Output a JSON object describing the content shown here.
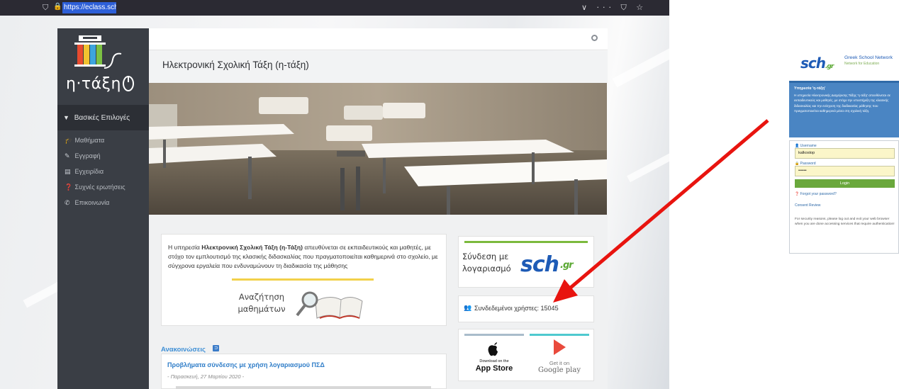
{
  "browser": {
    "url": "https://eclass.sch.gr",
    "toolbar_icons": "∨ ··· ⛉ ☆"
  },
  "site": {
    "logo_text": "η·τάξη",
    "page_title": "Ηλεκτρονική Σχολική Τάξη (η-τάξη)"
  },
  "sidebar": {
    "header": "Βασικές Επιλογές",
    "items": [
      {
        "label": "Μαθήματα",
        "icon": "graduation-cap-icon",
        "glyph": "🎓"
      },
      {
        "label": "Εγγραφή",
        "icon": "edit-icon",
        "glyph": "✎"
      },
      {
        "label": "Εγχειρίδια",
        "icon": "document-icon",
        "glyph": "▤"
      },
      {
        "label": "Συχνές ερωτήσεις",
        "icon": "question-circle-icon",
        "glyph": "❓"
      },
      {
        "label": "Επικοινωνία",
        "icon": "phone-icon",
        "glyph": "✆"
      }
    ]
  },
  "intro": {
    "text_before": "Η υπηρεσία ",
    "text_bold": "Ηλεκτρονική Σχολική Τάξη (η-Τάξη)",
    "text_after": " απευθύνεται σε εκπαιδευτικούς και μαθητές, με στόχο τον εμπλουτισμό της κλασικής διδασκαλίας που πραγματοποιείται καθημερινά στο σχολείο, με σύγχρονα εργαλεία που ενδυναμώνουν τη διαδικασία της μάθησης"
  },
  "course_search": {
    "label_line1": "Αναζήτηση",
    "label_line2": "μαθημάτων"
  },
  "announcements": {
    "title": "Ανακοινώσεις",
    "rss_glyph": "⊃",
    "items": [
      {
        "title": "Προβλήματα σύνδεσης με χρήση λογαριασμού ΠΣΔ",
        "date": "- Παρασκευή, 27 Μαρτίου 2020 -"
      }
    ]
  },
  "login_card": {
    "line1": "Σύνδεση με",
    "line2": "λογαριασμό",
    "logo": "sch",
    "logo_suffix": ".gr"
  },
  "online_users": {
    "text": "Συνδεδεμένοι χρήστες: 15045",
    "icon_glyph": "👥"
  },
  "apps": {
    "appstore_small": "Download on the",
    "appstore_big": "App Store",
    "googleplay_small": "Get it on",
    "googleplay_big": "Google play"
  },
  "sch_login": {
    "logo": "sch",
    "logo_suffix": ".gr",
    "network_name": "Greek School Network",
    "network_sub": "Network for Education",
    "info_title": "Υπηρεσία 'η-τάξη'",
    "info_text": "Η υπηρεσία Ηλεκτρονικής Διαχείρισης Τάξης 'η-τάξη' απευθύνεται σε εκπαιδευτικούς και μαθητές, με στόχο την υποστήριξη της κλασικής διδασκαλίας και την ενίσχυση της διαδικασίας μάθησης που πραγματοποιείται καθημερινά μέσα στη σχολική τάξη.",
    "username_label": "Username",
    "username_value": "kalkostop",
    "password_label": "Password",
    "password_value": "••••••",
    "login_button": "Login",
    "forgot_link": "Forgot your password?",
    "consent_link": "Consent Review",
    "security_text": "For security reasons, please log out and exit your web browser when you are done accessing services that require authentication!"
  },
  "colors": {
    "sidebar": "#3a3e45",
    "accent_blue": "#2f7dc8",
    "sch_green": "#6aa83c",
    "arrow_red": "#e8140f"
  }
}
